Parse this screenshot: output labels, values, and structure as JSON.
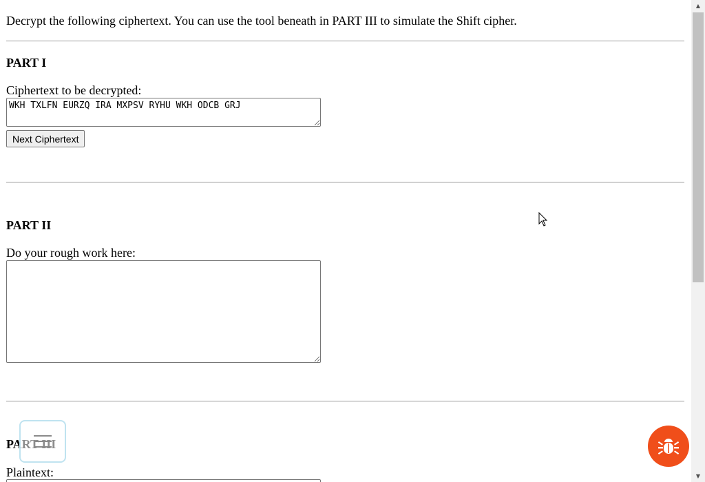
{
  "intro": {
    "text": "Decrypt the following ciphertext. You can use the tool beneath in PART III to simulate the Shift cipher."
  },
  "part1": {
    "heading": "PART I",
    "label": "Ciphertext to be decrypted:",
    "ciphertext": "WKH TXLFN EURZQ IRA MXPSV RYHU WKH ODCB GRJ",
    "next_button": "Next Ciphertext"
  },
  "part2": {
    "heading": "PART II",
    "label": "Do your rough work here:",
    "rough_work": ""
  },
  "part3": {
    "heading": "PART III",
    "label": "Plaintext:"
  },
  "icons": {
    "menu": "hamburger-menu-icon",
    "bug": "bug-icon",
    "cursor": "mouse-cursor-icon"
  },
  "colors": {
    "bug_fab": "#f04e1a",
    "menu_border": "#bfe3f0",
    "separator": "#9a9a9a"
  }
}
